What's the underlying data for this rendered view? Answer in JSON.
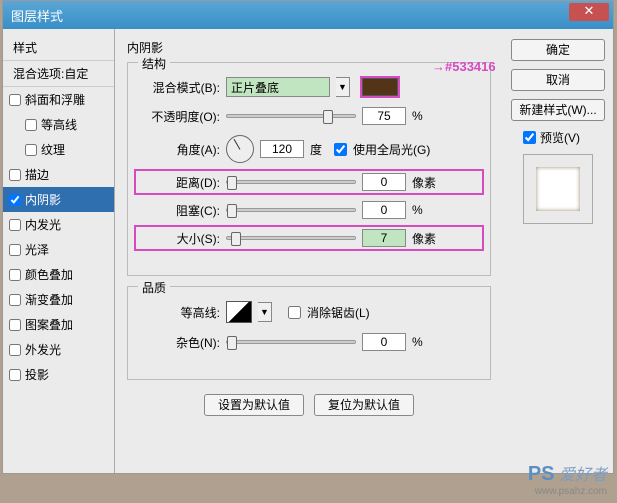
{
  "window": {
    "title": "图层样式"
  },
  "sidebar": {
    "header_styles": "样式",
    "header_blend": "混合选项:自定",
    "items": [
      {
        "label": "斜面和浮雕",
        "checked": false
      },
      {
        "label": "等高线",
        "checked": false,
        "indent": true
      },
      {
        "label": "纹理",
        "checked": false,
        "indent": true
      },
      {
        "label": "描边",
        "checked": false
      },
      {
        "label": "内阴影",
        "checked": true,
        "selected": true
      },
      {
        "label": "内发光",
        "checked": false
      },
      {
        "label": "光泽",
        "checked": false
      },
      {
        "label": "颜色叠加",
        "checked": false
      },
      {
        "label": "渐变叠加",
        "checked": false
      },
      {
        "label": "图案叠加",
        "checked": false
      },
      {
        "label": "外发光",
        "checked": false
      },
      {
        "label": "投影",
        "checked": false
      }
    ]
  },
  "main": {
    "title": "内阴影",
    "structure_legend": "结构",
    "blend_mode_label": "混合模式(B):",
    "blend_mode_value": "正片叠底",
    "color_hex": "#533416",
    "color_annot": "#533416",
    "opacity_label": "不透明度(O):",
    "opacity_value": "75",
    "opacity_unit": "%",
    "angle_label": "角度(A):",
    "angle_value": "120",
    "angle_unit": "度",
    "global_light_label": "使用全局光(G)",
    "global_light_checked": true,
    "distance_label": "距离(D):",
    "distance_value": "0",
    "distance_unit": "像素",
    "choke_label": "阻塞(C):",
    "choke_value": "0",
    "choke_unit": "%",
    "size_label": "大小(S):",
    "size_value": "7",
    "size_unit": "像素",
    "quality_legend": "品质",
    "contour_label": "等高线:",
    "antialias_label": "消除锯齿(L)",
    "noise_label": "杂色(N):",
    "noise_value": "0",
    "noise_unit": "%",
    "btn_default": "设置为默认值",
    "btn_reset": "复位为默认值"
  },
  "right": {
    "ok": "确定",
    "cancel": "取消",
    "new_style": "新建样式(W)...",
    "preview_label": "预览(V)"
  },
  "watermark": {
    "brand": "PS",
    "text": "爱好者",
    "url": "www.psahz.com"
  }
}
